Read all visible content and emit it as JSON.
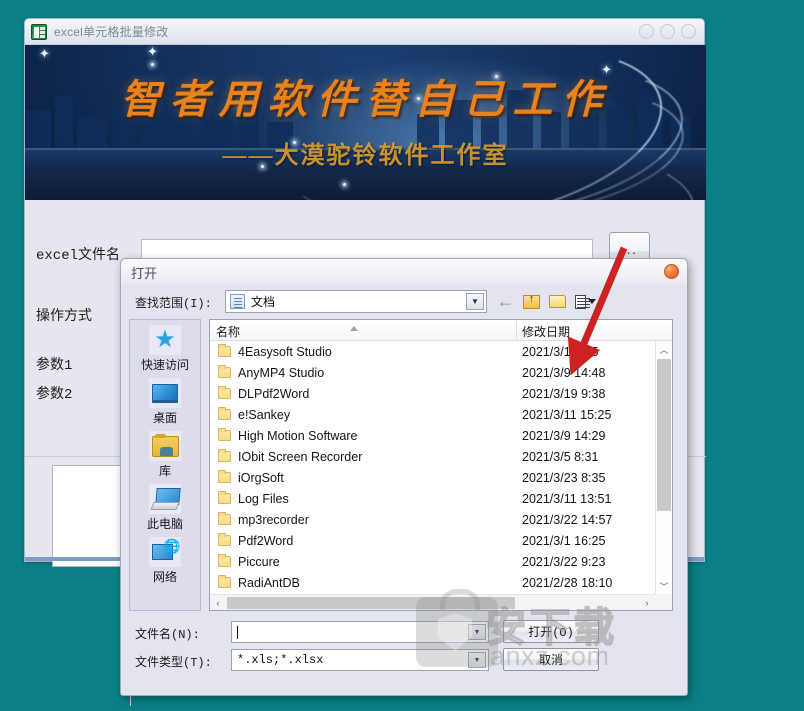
{
  "desktop": {
    "background_color": "#0a8084"
  },
  "app": {
    "title": "excel单元格批量修改",
    "icon": "excel-app-icon",
    "window_buttons": [
      "minimize",
      "maximize",
      "close"
    ],
    "banner": {
      "line1": "智者用软件替自己工作",
      "line2": "——大漠驼铃软件工作室"
    },
    "form": {
      "filename_label": "excel文件名",
      "filename_value": "",
      "browse_button": "...",
      "optype_label": "操作方式",
      "param1_label": "参数1",
      "param2_label": "参数2"
    }
  },
  "dialog": {
    "title": "打开",
    "close_button": "×",
    "lookin_label": "查找范围(I):",
    "lookin_value": "文档",
    "toolbar": {
      "back": "back-icon",
      "up": "up-one-level-icon",
      "new_folder": "new-folder-icon",
      "views": "views-icon"
    },
    "places": [
      {
        "label": "快速访问",
        "icon": "quick-access-star-icon"
      },
      {
        "label": "桌面",
        "icon": "desktop-icon"
      },
      {
        "label": "库",
        "icon": "library-icon"
      },
      {
        "label": "此电脑",
        "icon": "this-pc-icon"
      },
      {
        "label": "网络",
        "icon": "network-icon"
      }
    ],
    "columns": {
      "name": "名称",
      "date": "修改日期"
    },
    "files": [
      {
        "name": "4Easysoft Studio",
        "date": "2021/3/1 9:55"
      },
      {
        "name": "AnyMP4 Studio",
        "date": "2021/3/9 14:48"
      },
      {
        "name": "DLPdf2Word",
        "date": "2021/3/19 9:38"
      },
      {
        "name": "e!Sankey",
        "date": "2021/3/11 15:25"
      },
      {
        "name": "High Motion Software",
        "date": "2021/3/9 14:29"
      },
      {
        "name": "IObit Screen Recorder",
        "date": "2021/3/5 8:31"
      },
      {
        "name": "iOrgSoft",
        "date": "2021/3/23 8:35"
      },
      {
        "name": "Log Files",
        "date": "2021/3/11 13:51"
      },
      {
        "name": "mp3recorder",
        "date": "2021/3/22 14:57"
      },
      {
        "name": "Pdf2Word",
        "date": "2021/3/1 16:25"
      },
      {
        "name": "Piccure",
        "date": "2021/3/22 9:23"
      },
      {
        "name": "RadiAntDB",
        "date": "2021/2/28 18:10"
      }
    ],
    "filename_label": "文件名(N):",
    "filename_value": "",
    "filetype_label": "文件类型(T):",
    "filetype_value": "*.xls;*.xlsx",
    "open_button": "打开(O)",
    "cancel_button": "取消"
  },
  "watermark": {
    "cn": "安下载",
    "en": "anxz.com"
  },
  "annotation": {
    "arrow_color": "#cc2222"
  }
}
